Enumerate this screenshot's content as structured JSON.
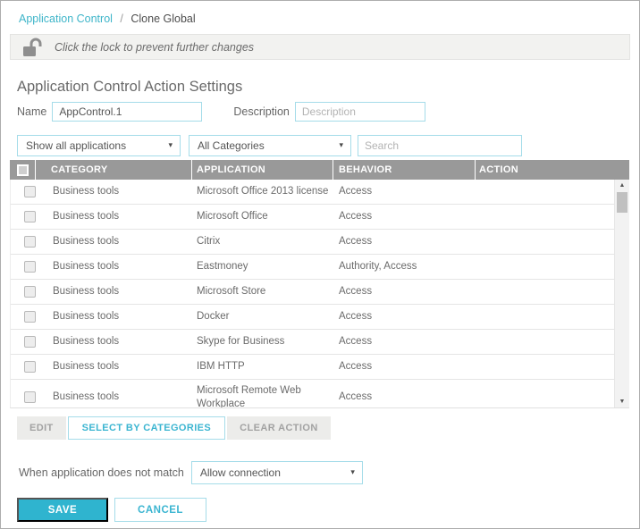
{
  "breadcrumb": {
    "link": "Application Control",
    "separator": "/",
    "current": "Clone Global"
  },
  "lock_bar": {
    "message": "Click the lock to prevent further changes"
  },
  "page_title": "Application Control Action Settings",
  "form": {
    "name_label": "Name",
    "name_value": "AppControl.1",
    "description_label": "Description",
    "description_placeholder": "Description"
  },
  "filters": {
    "application_filter_value": "Show all applications",
    "category_filter_value": "All Categories",
    "search_placeholder": "Search"
  },
  "table": {
    "columns": {
      "category": "CATEGORY",
      "application": "APPLICATION",
      "behavior": "BEHAVIOR",
      "action": "ACTION"
    },
    "rows": [
      {
        "category": "Business tools",
        "application": "Microsoft Office 2013 license",
        "behavior": "Access",
        "action": ""
      },
      {
        "category": "Business tools",
        "application": "Microsoft Office",
        "behavior": "Access",
        "action": ""
      },
      {
        "category": "Business tools",
        "application": "Citrix",
        "behavior": "Access",
        "action": ""
      },
      {
        "category": "Business tools",
        "application": "Eastmoney",
        "behavior": "Authority, Access",
        "action": ""
      },
      {
        "category": "Business tools",
        "application": "Microsoft Store",
        "behavior": "Access",
        "action": ""
      },
      {
        "category": "Business tools",
        "application": "Docker",
        "behavior": "Access",
        "action": ""
      },
      {
        "category": "Business tools",
        "application": "Skype for Business",
        "behavior": "Access",
        "action": ""
      },
      {
        "category": "Business tools",
        "application": "IBM HTTP",
        "behavior": "Access",
        "action": ""
      },
      {
        "category": "Business tools",
        "application": "Microsoft Remote Web Workplace",
        "behavior": "Access",
        "action": ""
      }
    ]
  },
  "action_buttons": {
    "edit": "EDIT",
    "select_by_categories": "SELECT BY CATEGORIES",
    "clear_action": "CLEAR ACTION"
  },
  "no_match": {
    "label": "When application does not match",
    "selected_value": "Allow connection"
  },
  "footer": {
    "save": "SAVE",
    "cancel": "CANCEL"
  },
  "icons": {
    "dropdown_arrow": "▾",
    "scroll_up": "▲",
    "scroll_down": "▼"
  },
  "colors": {
    "accent": "#2fb4cf",
    "accent_border": "#a5dce9",
    "table_header_bg": "#999999"
  }
}
